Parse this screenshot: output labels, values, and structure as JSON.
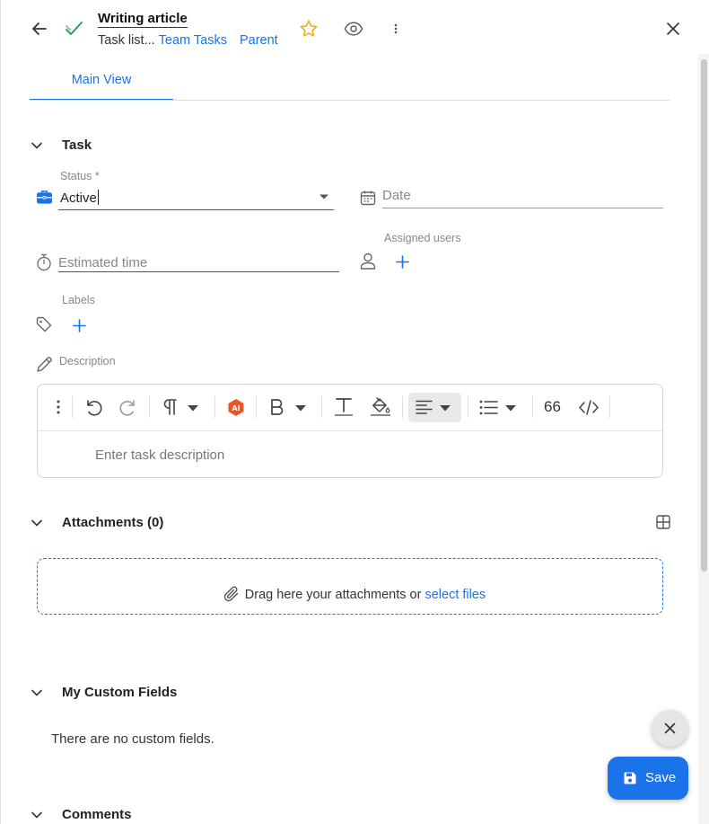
{
  "header": {
    "title": "Writing article",
    "breadcrumb_text": "Task list...",
    "breadcrumb_link1": "Team Tasks",
    "breadcrumb_link2": "Parent"
  },
  "tabs": [
    {
      "label": "Main View",
      "active": true
    }
  ],
  "task_section": {
    "title": "Task",
    "status_label": "Status *",
    "status_value": "Active",
    "date_placeholder": "Date",
    "estimated_time_placeholder": "Estimated time",
    "assigned_users_label": "Assigned users",
    "labels_label": "Labels",
    "description_label": "Description",
    "description_placeholder": "Enter task description",
    "toolbar_quote_label": "66"
  },
  "attachments": {
    "title": "Attachments (0)",
    "drop_text": "Drag here your attachments or",
    "select_link": "select files"
  },
  "custom_fields": {
    "title": "My Custom Fields",
    "empty_text": "There are no custom fields."
  },
  "comments": {
    "title": "Comments"
  },
  "actions": {
    "save_label": "Save"
  },
  "colors": {
    "accent": "#1a73e8",
    "check": "#2e9e57",
    "star": "#f2a900",
    "ai_badge": "#e8562a",
    "status_icon": "#1a73e8"
  }
}
